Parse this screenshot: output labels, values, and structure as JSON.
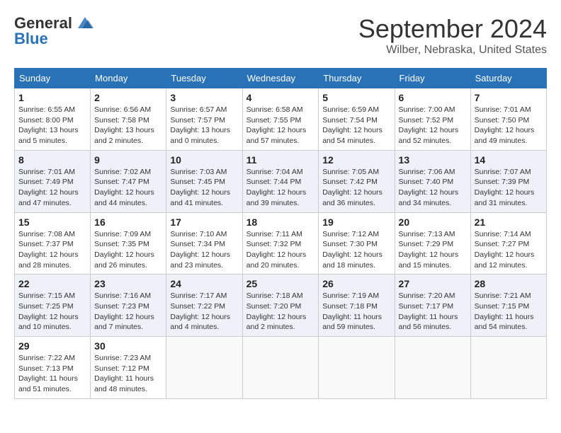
{
  "logo": {
    "line1": "General",
    "line2": "Blue"
  },
  "title": "September 2024",
  "location": "Wilber, Nebraska, United States",
  "headers": [
    "Sunday",
    "Monday",
    "Tuesday",
    "Wednesday",
    "Thursday",
    "Friday",
    "Saturday"
  ],
  "weeks": [
    [
      {
        "day": "1",
        "sunrise": "Sunrise: 6:55 AM",
        "sunset": "Sunset: 8:00 PM",
        "daylight": "Daylight: 13 hours and 5 minutes."
      },
      {
        "day": "2",
        "sunrise": "Sunrise: 6:56 AM",
        "sunset": "Sunset: 7:58 PM",
        "daylight": "Daylight: 13 hours and 2 minutes."
      },
      {
        "day": "3",
        "sunrise": "Sunrise: 6:57 AM",
        "sunset": "Sunset: 7:57 PM",
        "daylight": "Daylight: 13 hours and 0 minutes."
      },
      {
        "day": "4",
        "sunrise": "Sunrise: 6:58 AM",
        "sunset": "Sunset: 7:55 PM",
        "daylight": "Daylight: 12 hours and 57 minutes."
      },
      {
        "day": "5",
        "sunrise": "Sunrise: 6:59 AM",
        "sunset": "Sunset: 7:54 PM",
        "daylight": "Daylight: 12 hours and 54 minutes."
      },
      {
        "day": "6",
        "sunrise": "Sunrise: 7:00 AM",
        "sunset": "Sunset: 7:52 PM",
        "daylight": "Daylight: 12 hours and 52 minutes."
      },
      {
        "day": "7",
        "sunrise": "Sunrise: 7:01 AM",
        "sunset": "Sunset: 7:50 PM",
        "daylight": "Daylight: 12 hours and 49 minutes."
      }
    ],
    [
      {
        "day": "8",
        "sunrise": "Sunrise: 7:01 AM",
        "sunset": "Sunset: 7:49 PM",
        "daylight": "Daylight: 12 hours and 47 minutes."
      },
      {
        "day": "9",
        "sunrise": "Sunrise: 7:02 AM",
        "sunset": "Sunset: 7:47 PM",
        "daylight": "Daylight: 12 hours and 44 minutes."
      },
      {
        "day": "10",
        "sunrise": "Sunrise: 7:03 AM",
        "sunset": "Sunset: 7:45 PM",
        "daylight": "Daylight: 12 hours and 41 minutes."
      },
      {
        "day": "11",
        "sunrise": "Sunrise: 7:04 AM",
        "sunset": "Sunset: 7:44 PM",
        "daylight": "Daylight: 12 hours and 39 minutes."
      },
      {
        "day": "12",
        "sunrise": "Sunrise: 7:05 AM",
        "sunset": "Sunset: 7:42 PM",
        "daylight": "Daylight: 12 hours and 36 minutes."
      },
      {
        "day": "13",
        "sunrise": "Sunrise: 7:06 AM",
        "sunset": "Sunset: 7:40 PM",
        "daylight": "Daylight: 12 hours and 34 minutes."
      },
      {
        "day": "14",
        "sunrise": "Sunrise: 7:07 AM",
        "sunset": "Sunset: 7:39 PM",
        "daylight": "Daylight: 12 hours and 31 minutes."
      }
    ],
    [
      {
        "day": "15",
        "sunrise": "Sunrise: 7:08 AM",
        "sunset": "Sunset: 7:37 PM",
        "daylight": "Daylight: 12 hours and 28 minutes."
      },
      {
        "day": "16",
        "sunrise": "Sunrise: 7:09 AM",
        "sunset": "Sunset: 7:35 PM",
        "daylight": "Daylight: 12 hours and 26 minutes."
      },
      {
        "day": "17",
        "sunrise": "Sunrise: 7:10 AM",
        "sunset": "Sunset: 7:34 PM",
        "daylight": "Daylight: 12 hours and 23 minutes."
      },
      {
        "day": "18",
        "sunrise": "Sunrise: 7:11 AM",
        "sunset": "Sunset: 7:32 PM",
        "daylight": "Daylight: 12 hours and 20 minutes."
      },
      {
        "day": "19",
        "sunrise": "Sunrise: 7:12 AM",
        "sunset": "Sunset: 7:30 PM",
        "daylight": "Daylight: 12 hours and 18 minutes."
      },
      {
        "day": "20",
        "sunrise": "Sunrise: 7:13 AM",
        "sunset": "Sunset: 7:29 PM",
        "daylight": "Daylight: 12 hours and 15 minutes."
      },
      {
        "day": "21",
        "sunrise": "Sunrise: 7:14 AM",
        "sunset": "Sunset: 7:27 PM",
        "daylight": "Daylight: 12 hours and 12 minutes."
      }
    ],
    [
      {
        "day": "22",
        "sunrise": "Sunrise: 7:15 AM",
        "sunset": "Sunset: 7:25 PM",
        "daylight": "Daylight: 12 hours and 10 minutes."
      },
      {
        "day": "23",
        "sunrise": "Sunrise: 7:16 AM",
        "sunset": "Sunset: 7:23 PM",
        "daylight": "Daylight: 12 hours and 7 minutes."
      },
      {
        "day": "24",
        "sunrise": "Sunrise: 7:17 AM",
        "sunset": "Sunset: 7:22 PM",
        "daylight": "Daylight: 12 hours and 4 minutes."
      },
      {
        "day": "25",
        "sunrise": "Sunrise: 7:18 AM",
        "sunset": "Sunset: 7:20 PM",
        "daylight": "Daylight: 12 hours and 2 minutes."
      },
      {
        "day": "26",
        "sunrise": "Sunrise: 7:19 AM",
        "sunset": "Sunset: 7:18 PM",
        "daylight": "Daylight: 11 hours and 59 minutes."
      },
      {
        "day": "27",
        "sunrise": "Sunrise: 7:20 AM",
        "sunset": "Sunset: 7:17 PM",
        "daylight": "Daylight: 11 hours and 56 minutes."
      },
      {
        "day": "28",
        "sunrise": "Sunrise: 7:21 AM",
        "sunset": "Sunset: 7:15 PM",
        "daylight": "Daylight: 11 hours and 54 minutes."
      }
    ],
    [
      {
        "day": "29",
        "sunrise": "Sunrise: 7:22 AM",
        "sunset": "Sunset: 7:13 PM",
        "daylight": "Daylight: 11 hours and 51 minutes."
      },
      {
        "day": "30",
        "sunrise": "Sunrise: 7:23 AM",
        "sunset": "Sunset: 7:12 PM",
        "daylight": "Daylight: 11 hours and 48 minutes."
      },
      null,
      null,
      null,
      null,
      null
    ]
  ]
}
